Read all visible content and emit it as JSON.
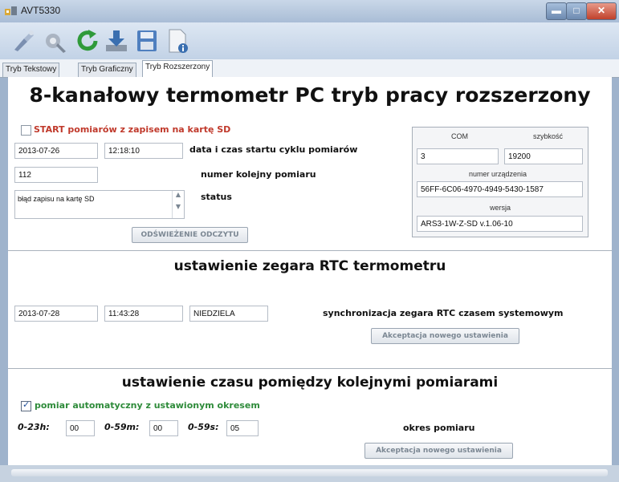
{
  "window": {
    "title": "AVT5330"
  },
  "tabs": [
    {
      "label": "Tryb Tekstowy"
    },
    {
      "label": "Tryb Graficzny"
    },
    {
      "label": "Tryb Rozszerzony"
    }
  ],
  "toolbar": {
    "icons": [
      "connect-icon",
      "settings-gear-icon",
      "refresh-icon",
      "download-icon",
      "save-icon",
      "document-info-icon"
    ]
  },
  "main": {
    "title": "8-kanałowy termometr PC tryb pracy rozszerzony",
    "start_checkbox_label": "START pomiarów z zapisem na kartę SD",
    "start_date": "2013-07-26",
    "start_time": "12:18:10",
    "start_label": "data i czas startu cyklu pomiarów",
    "measure_number": "112",
    "measure_label": "numer kolejny pomiaru",
    "status_value": "błąd zapisu na kartę SD",
    "status_label": "status",
    "refresh_button": "ODŚWIEŻENIE ODCZYTU"
  },
  "com_box": {
    "com_label": "COM",
    "speed_label": "szybkość",
    "com_value": "3",
    "speed_value": "19200",
    "device_label": "numer urządzenia",
    "device_value": "56FF-6C06-4970-4949-5430-1587",
    "version_label": "wersja",
    "version_value": "ARS3-1W-Z-SD v.1.06-10"
  },
  "rtc": {
    "title": "ustawienie zegara RTC termometru",
    "date": "2013-07-28",
    "time": "11:43:28",
    "day": "NIEDZIELA",
    "sync_label": "synchronizacja zegara RTC czasem systemowym",
    "accept_button": "Akceptacja nowego ustawienia"
  },
  "interval": {
    "title": "ustawienie czasu pomiędzy kolejnymi pomiarami",
    "auto_label": "pomiar automatyczny z ustawionym okresem",
    "auto_checked": true,
    "hours_label": "0-23h:",
    "hours_value": "00",
    "minutes_label": "0-59m:",
    "minutes_value": "00",
    "seconds_label": "0-59s:",
    "seconds_value": "05",
    "period_label": "okres pomiaru",
    "accept_button": "Akceptacja nowego ustawienia"
  },
  "colors": {
    "accent_red": "#c0392b",
    "accent_green": "#2e8b3a",
    "title_bar": "#b7c8de"
  }
}
